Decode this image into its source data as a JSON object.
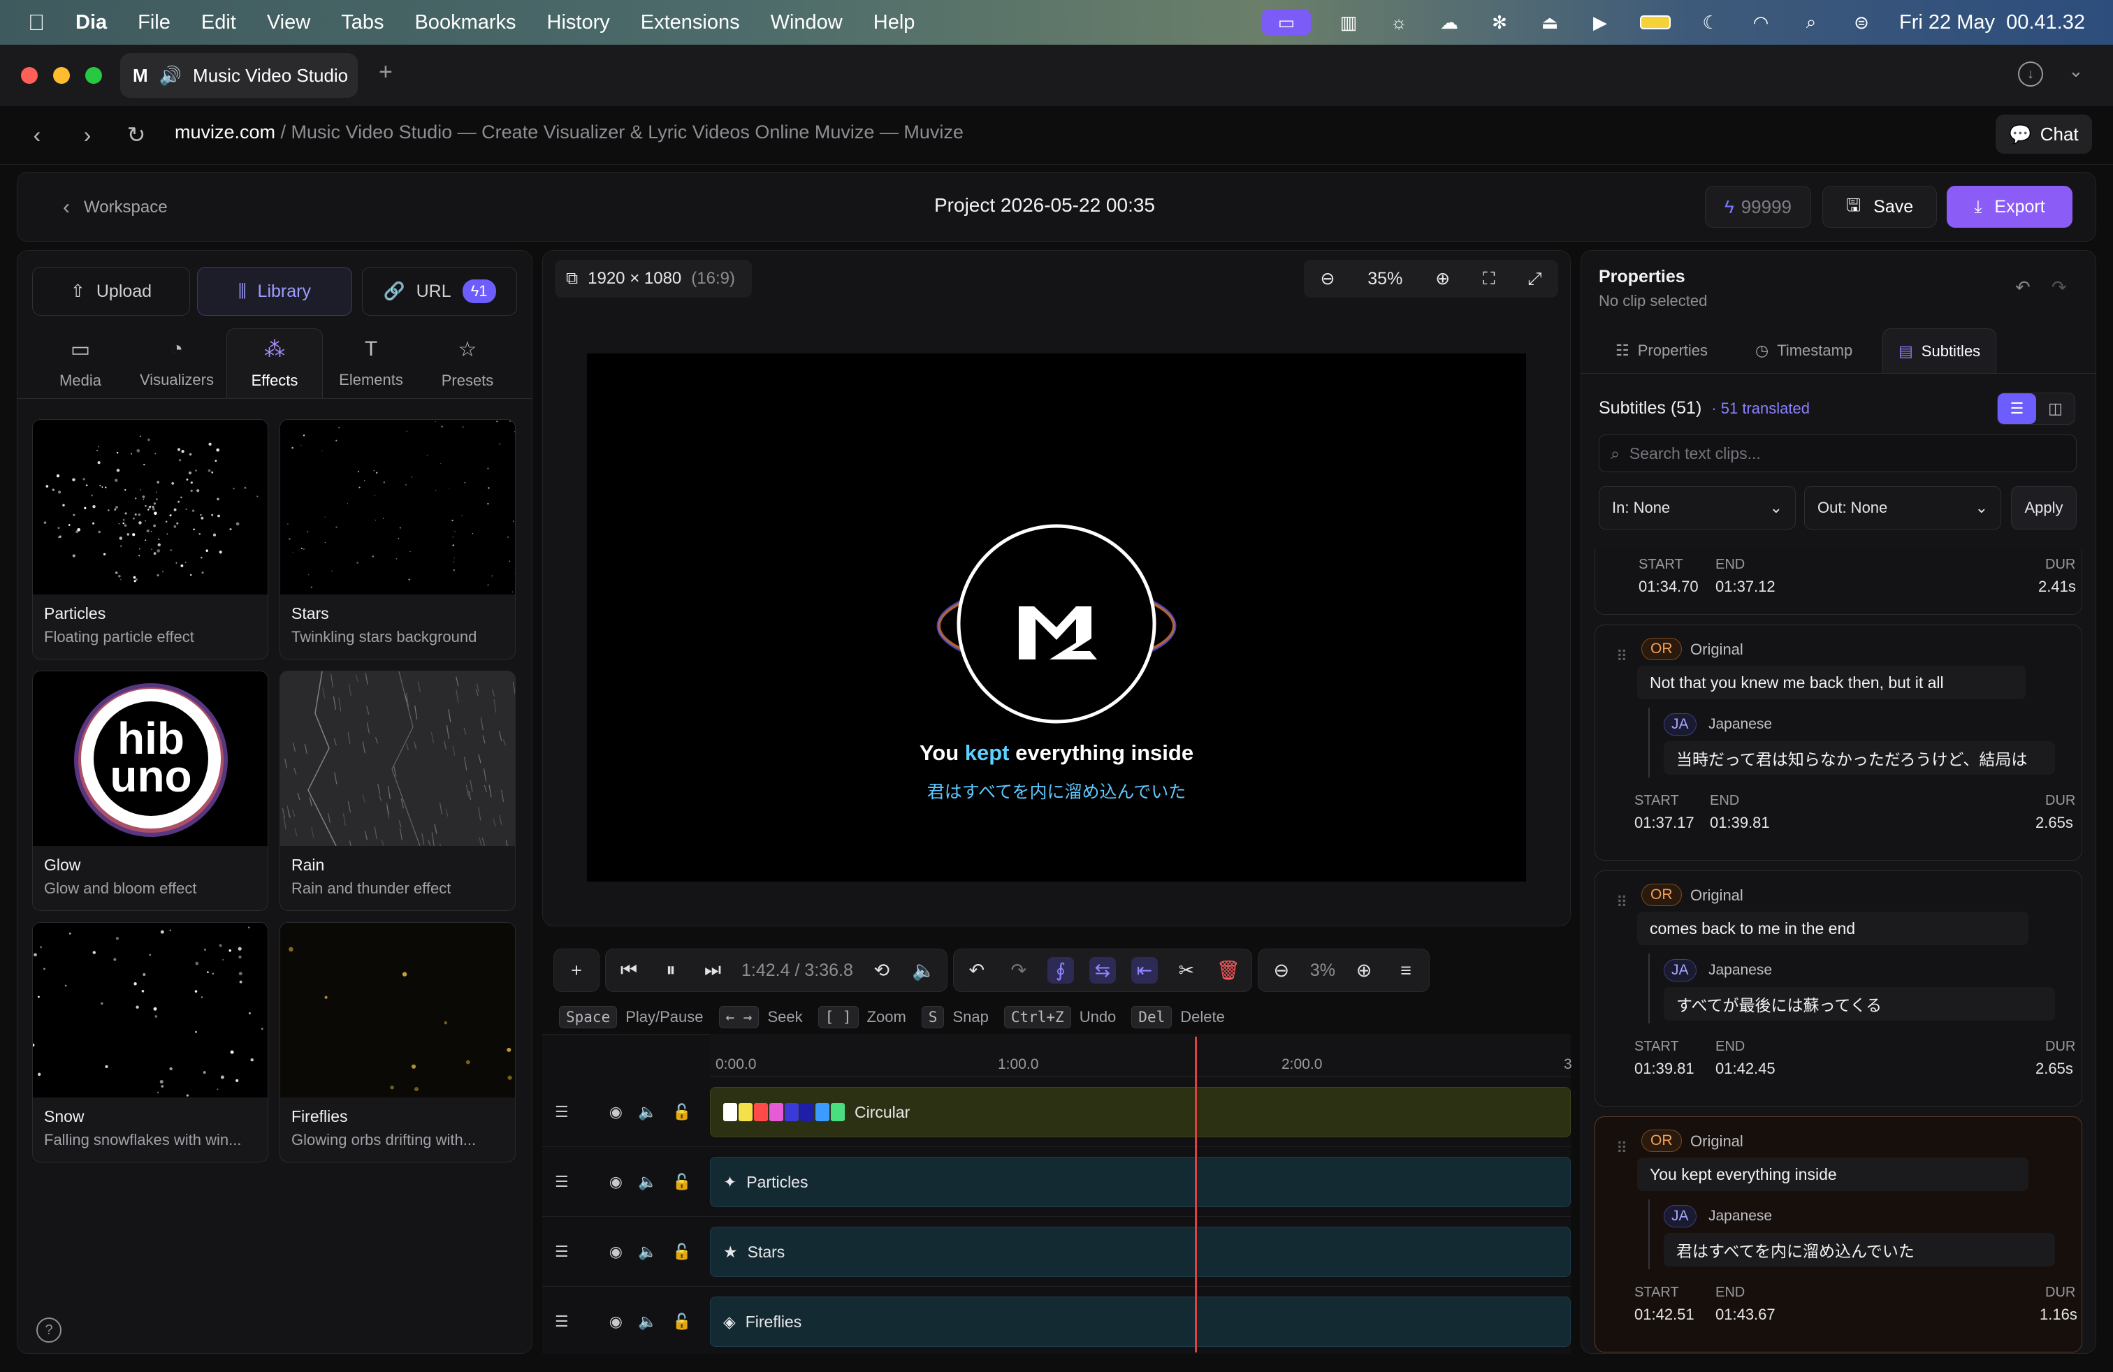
{
  "menubar": {
    "app": "Dia",
    "items": [
      "File",
      "Edit",
      "View",
      "Tabs",
      "Bookmarks",
      "History",
      "Extensions",
      "Window",
      "Help"
    ],
    "clock": "Fri 22 May  00.41.32"
  },
  "browser": {
    "tab_title": "Music Video Studio",
    "url_host": "muvize.com",
    "url_path": " / Music Video Studio — Create Visualizer & Lyric Videos Online Muvize — Muvize",
    "chat_label": "Chat"
  },
  "header": {
    "back_label": "Workspace",
    "project_title": "Project 2026-05-22 00:35",
    "credits": "99999",
    "save_label": "Save",
    "export_label": "Export"
  },
  "left": {
    "upload_label": "Upload",
    "library_label": "Library",
    "url_label": "URL",
    "url_badge": "1",
    "categories": [
      "Media",
      "Visualizers",
      "Effects",
      "Elements",
      "Presets"
    ],
    "active_category": "Effects",
    "effects": [
      {
        "title": "Particles",
        "desc": "Floating particle effect"
      },
      {
        "title": "Stars",
        "desc": "Twinkling stars background"
      },
      {
        "title": "Glow",
        "desc": "Glow and bloom effect"
      },
      {
        "title": "Rain",
        "desc": "Rain and thunder effect"
      },
      {
        "title": "Snow",
        "desc": "Falling snowflakes with win..."
      },
      {
        "title": "Fireflies",
        "desc": "Glowing orbs drifting with..."
      }
    ],
    "glow_logo_text": "hib uno"
  },
  "canvas": {
    "resolution": "1920 × 1080",
    "ratio": "(16:9)",
    "zoom": "35%",
    "lyric_pre": "You ",
    "lyric_hl": "kept",
    "lyric_post": " everything inside",
    "lyric_translation": "君はすべてを内に溜め込んでいた"
  },
  "transport": {
    "timecode": "1:42.4 / 3:36.8",
    "timeline_zoom": "3%"
  },
  "shortcuts": [
    {
      "key": "Space",
      "label": "Play/Pause"
    },
    {
      "key": "← →",
      "label": "Seek"
    },
    {
      "key": "[ ]",
      "label": "Zoom"
    },
    {
      "key": "S",
      "label": "Snap"
    },
    {
      "key": "Ctrl+Z",
      "label": "Undo"
    },
    {
      "key": "Del",
      "label": "Delete"
    }
  ],
  "timeline": {
    "ticks": [
      "0:00.0",
      "1:00.0",
      "2:00.0",
      "3"
    ],
    "playhead_time": "1:42.4",
    "tracks": [
      {
        "name": "Circular",
        "style": "yellow",
        "icon": "swatches"
      },
      {
        "name": "Particles",
        "style": "teal",
        "icon": "✦"
      },
      {
        "name": "Stars",
        "style": "teal",
        "icon": "★"
      },
      {
        "name": "Fireflies",
        "style": "teal",
        "icon": "◈"
      }
    ],
    "swatches": [
      "#ffffff",
      "#f5e04a",
      "#ff4a4a",
      "#e65cd8",
      "#3a3ad8",
      "#1e1ea8",
      "#3a9cff",
      "#4ade80"
    ]
  },
  "properties": {
    "title": "Properties",
    "subtitle": "No clip selected",
    "tabs": [
      "Properties",
      "Timestamp",
      "Subtitles"
    ],
    "active_tab": "Subtitles",
    "subtitles_count": "Subtitles (51)",
    "translated": "· 51 translated",
    "search_placeholder": "Search text clips...",
    "in_select": "In: None",
    "out_select": "Out: None",
    "apply_label": "Apply",
    "meta_labels": {
      "start": "START",
      "end": "END",
      "dur": "DUR"
    },
    "or_tag": "OR",
    "or_name": "Original",
    "ja_tag": "JA",
    "ja_name": "Japanese",
    "partial": {
      "start": "01:34.70",
      "end": "01:37.12",
      "dur": "2.41s"
    },
    "clips": [
      {
        "original": "Not that you knew me back then, but it all",
        "japanese": "当時だって君は知らなかっただろうけど、結局は",
        "start": "01:37.17",
        "end": "01:39.81",
        "dur": "2.65s"
      },
      {
        "original": "comes back to me in the end",
        "japanese": "すべてが最後には蘇ってくる",
        "start": "01:39.81",
        "end": "01:42.45",
        "dur": "2.65s"
      },
      {
        "original": "You kept everything inside",
        "japanese": "君はすべてを内に溜め込んでいた",
        "start": "01:42.51",
        "end": "01:43.67",
        "dur": "1.16s"
      }
    ]
  }
}
